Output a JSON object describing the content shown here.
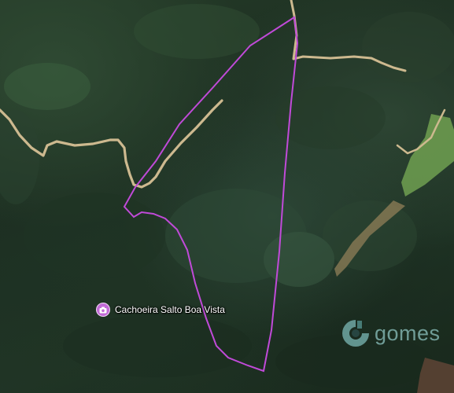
{
  "map": {
    "poi": {
      "label": "Cachoeira Salto Boa Vista",
      "icon": "camera-icon",
      "color": "#c26ad6"
    },
    "watermark": {
      "text": "gomes",
      "color": "#7fb1ad"
    },
    "boundary_color": "#c04ad8",
    "road_color": "#cdb98f",
    "pasture_color": "#6b9a4f"
  }
}
